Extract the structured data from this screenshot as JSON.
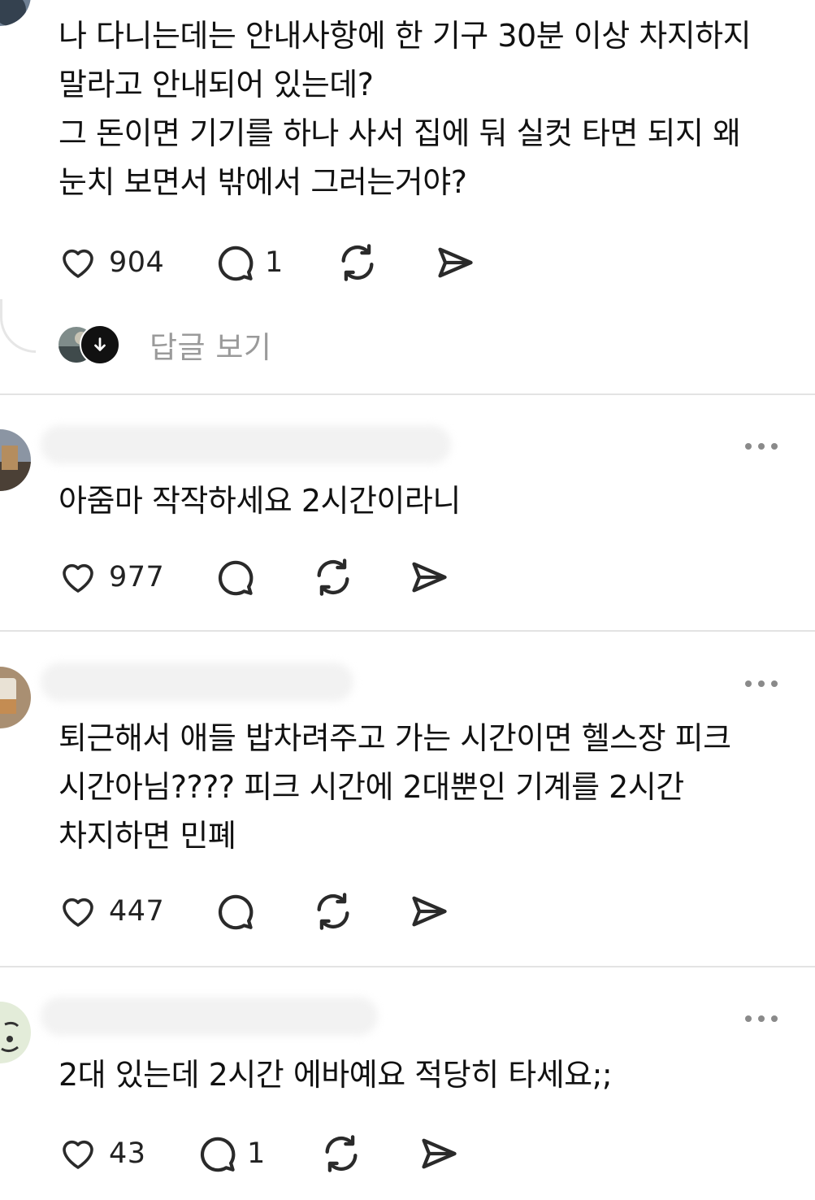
{
  "comments": [
    {
      "text": "나 다니는데는 안내사항에 한 기구 30분 이상 차지하지\n말라고 안내되어 있는데?\n그 돈이면 기기를 하나 사서 집에 둬 실컷 타면 되지 왜\n눈치 보면서 밖에서 그러는거야?",
      "likes": "904",
      "replies": "1",
      "view_replies_label": "답글 보기"
    },
    {
      "text": "아줌마 작작하세요 2시간이라니",
      "likes": "977",
      "replies": ""
    },
    {
      "text": "퇴근해서 애들 밥차려주고 가는 시간이면 헬스장 피크\n시간아님???? 피크 시간에 2대뿐인 기계를 2시간\n차지하면 민폐",
      "likes": "447",
      "replies": ""
    },
    {
      "text": "2대 있는데 2시간 에바예요 적당히 타세요;;",
      "likes": "43",
      "replies": "1"
    }
  ],
  "icons": {
    "like": "heart-icon",
    "reply": "speech-bubble-icon",
    "repost": "repost-icon",
    "share": "send-icon",
    "more": "more-dots-icon",
    "expand": "arrow-down-icon"
  },
  "colors": {
    "text": "#111111",
    "icon": "#2a2a2a",
    "muted": "#9a9a9a",
    "divider": "#e3e3e3"
  }
}
